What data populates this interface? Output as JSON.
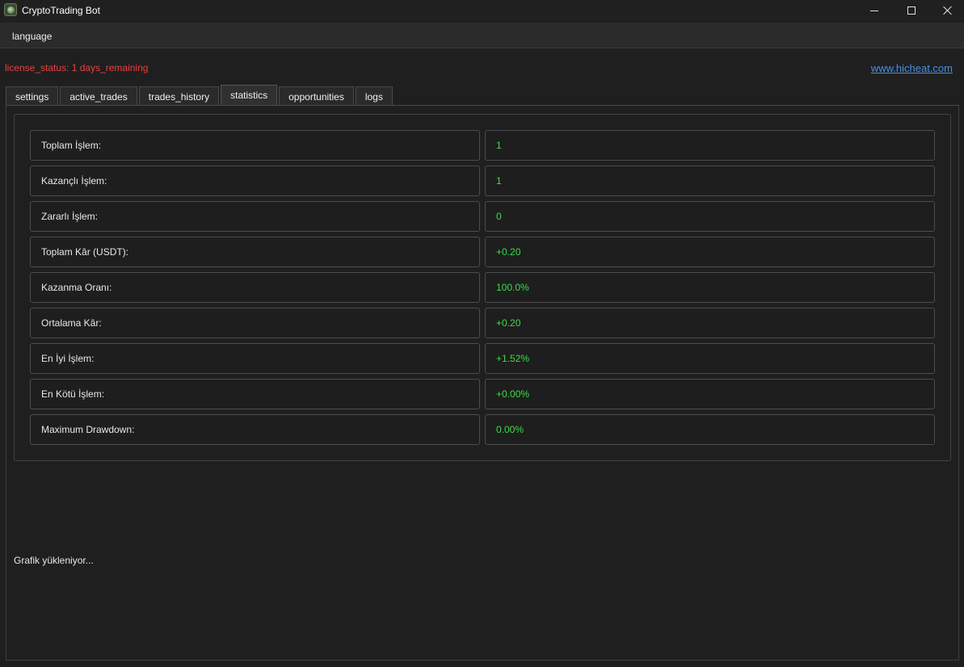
{
  "window": {
    "title": "CryptoTrading Bot"
  },
  "menu": {
    "language": "language"
  },
  "header": {
    "license_status": "license_status: 1 days_remaining",
    "website": "www.hicheat.com"
  },
  "tabs": [
    {
      "label": "settings"
    },
    {
      "label": "active_trades"
    },
    {
      "label": "trades_history"
    },
    {
      "label": "statistics",
      "active": true
    },
    {
      "label": "opportunities"
    },
    {
      "label": "logs"
    }
  ],
  "statistics": [
    {
      "label": "Toplam İşlem:",
      "value": "1"
    },
    {
      "label": "Kazançlı İşlem:",
      "value": "1"
    },
    {
      "label": "Zararlı İşlem:",
      "value": "0"
    },
    {
      "label": "Toplam Kâr (USDT):",
      "value": "+0.20"
    },
    {
      "label": "Kazanma Oranı:",
      "value": "100.0%"
    },
    {
      "label": "Ortalama Kâr:",
      "value": "+0.20"
    },
    {
      "label": "En İyi İşlem:",
      "value": "+1.52%"
    },
    {
      "label": "En Kötü İşlem:",
      "value": "+0.00%"
    },
    {
      "label": "Maximum Drawdown:",
      "value": "0.00%"
    }
  ],
  "chart_status": "Grafik yükleniyor...",
  "colors": {
    "value_green": "#3ddc4a",
    "license_red": "#e8413f",
    "link_blue": "#4a90e2"
  }
}
